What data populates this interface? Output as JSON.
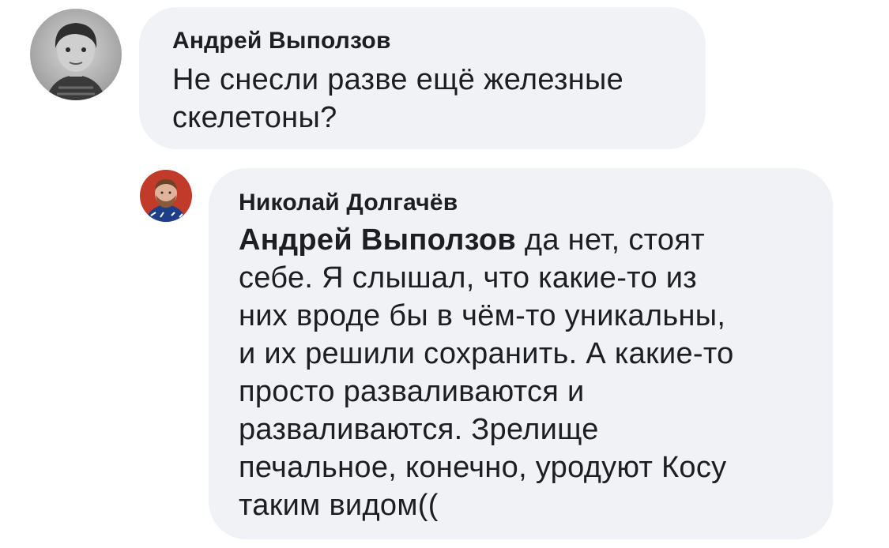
{
  "comments": [
    {
      "author": "Андрей Выползов",
      "lines": [
        "Не снесли разве ещё железные",
        "скелетоны?"
      ],
      "avatar_icon": "user-avatar-icon"
    },
    {
      "author": "Николай Долгачёв",
      "mention": "Андрей Выползов",
      "first_line_rest": " да нет, стоят",
      "lines": [
        "себе. Я слышал, что какие-то из",
        "них вроде бы в чём-то уникальны,",
        "и их решили сохранить. А какие-то",
        "просто разваливаются и",
        "разваливаются. Зрелище",
        "печальное, конечно, уродуют Косу",
        "таким видом(("
      ],
      "avatar_icon": "user-avatar-icon"
    }
  ],
  "colors": {
    "bubble": "#f0f2f5",
    "text": "#1c1e21"
  }
}
